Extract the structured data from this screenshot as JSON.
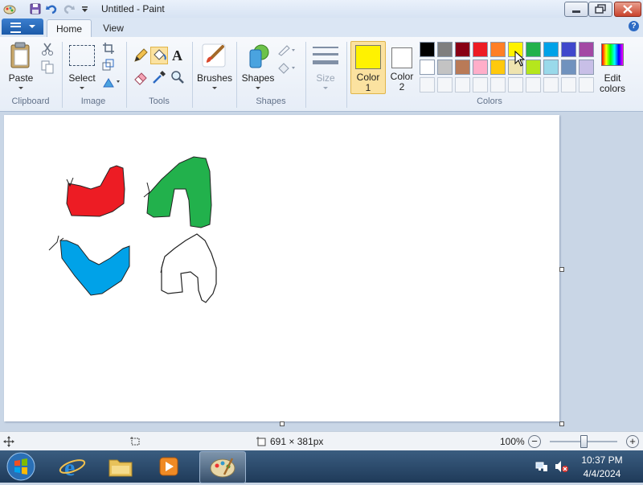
{
  "window": {
    "title": "Untitled - Paint"
  },
  "tabs": {
    "home": "Home",
    "view": "View",
    "help": "?"
  },
  "ribbon": {
    "clipboard": {
      "paste_label": "Paste",
      "group_label": "Clipboard"
    },
    "image": {
      "select_label": "Select",
      "group_label": "Image"
    },
    "tools": {
      "group_label": "Tools",
      "text_tool_glyph": "A"
    },
    "brushes": {
      "label": "Brushes"
    },
    "shapes": {
      "label": "Shapes",
      "group_label": "Shapes"
    },
    "size": {
      "label": "Size"
    },
    "colors": {
      "color1_label": "Color",
      "color1_num": "1",
      "color2_label": "Color",
      "color2_num": "2",
      "edit_label": "Edit",
      "edit_label2": "colors",
      "group_label": "Colors",
      "color1_value": "#fff200",
      "color2_value": "#ffffff",
      "palette_row1": [
        "#000000",
        "#7f7f7f",
        "#880015",
        "#ed1c24",
        "#ff7f27",
        "#fff200",
        "#22b14c",
        "#00a2e8",
        "#3f48cc",
        "#a349a4"
      ],
      "palette_row2": [
        "#ffffff",
        "#c3c3c3",
        "#b97a57",
        "#ffaec9",
        "#ffc90e",
        "#efe4b0",
        "#b5e61d",
        "#99d9ea",
        "#7092be",
        "#c8bfe7"
      ]
    }
  },
  "canvas": {
    "shapes": [
      {
        "name": "red-shape",
        "fill": "#ed1c24"
      },
      {
        "name": "green-shape",
        "fill": "#22b14c"
      },
      {
        "name": "blue-shape",
        "fill": "#00a2e8"
      },
      {
        "name": "outline-shape",
        "fill": "none"
      }
    ]
  },
  "status": {
    "dimensions": "691 × 381px",
    "zoom": "100%",
    "zoom_minus": "−",
    "zoom_plus": "+"
  },
  "taskbar": {
    "time": "10:37 PM",
    "date": "4/4/2024"
  }
}
